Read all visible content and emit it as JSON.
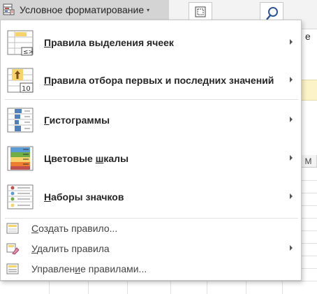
{
  "ribbon": {
    "conditional_formatting_label": "Условное форматирование",
    "side_letter": "е",
    "column_m": "М"
  },
  "menu": {
    "items": [
      {
        "label_pre": "",
        "label_u": "П",
        "label_post": "равила выделения ячеек",
        "icon": "highlight-cells-rules-icon",
        "has_submenu": true
      },
      {
        "label_pre": "",
        "label_u": "П",
        "label_post": "равила отбора первых и последних значений",
        "icon": "top-bottom-rules-icon",
        "has_submenu": true
      },
      {
        "label_pre": "",
        "label_u": "Г",
        "label_post": "истограммы",
        "icon": "data-bars-icon",
        "has_submenu": true
      },
      {
        "label_pre": "Цветовые ",
        "label_u": "ш",
        "label_post": "калы",
        "icon": "color-scales-icon",
        "has_submenu": true
      },
      {
        "label_pre": "",
        "label_u": "Н",
        "label_post": "аборы значков",
        "icon": "icon-sets-icon",
        "has_submenu": true
      }
    ],
    "actions": [
      {
        "label_pre": "",
        "label_u": "С",
        "label_post": "оздать правило...",
        "icon": "new-rule-icon",
        "has_submenu": false
      },
      {
        "label_pre": "",
        "label_u": "У",
        "label_post": "далить правила",
        "icon": "clear-rules-icon",
        "has_submenu": true
      },
      {
        "label_pre": "Управлен",
        "label_u": "и",
        "label_post": "е правилами...",
        "icon": "manage-rules-icon",
        "has_submenu": false
      }
    ],
    "icon_texts": {
      "less_greater": "≤>",
      "ten": "10"
    }
  },
  "colors": {
    "menu_bg": "#ffffff",
    "menu_border": "#c6c6c6",
    "button_active": "#d4d4d4",
    "highlight_yellow": "#f6d36b",
    "bar_blue": "#4f81bd",
    "arrow_orange": "#e8a33d"
  }
}
